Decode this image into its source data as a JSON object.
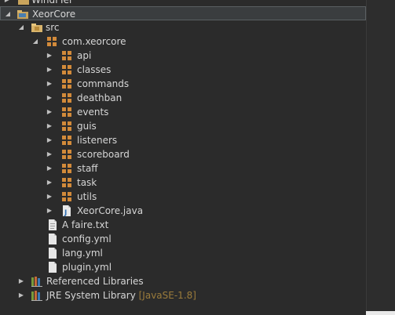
{
  "tree": {
    "top_partial": {
      "label": "WindFIer"
    },
    "project": {
      "label": "XeorCore"
    },
    "src_folder": {
      "label": "src"
    },
    "root_package": {
      "label": "com.xeorcore"
    },
    "packages": [
      {
        "label": "api"
      },
      {
        "label": "classes"
      },
      {
        "label": "commands"
      },
      {
        "label": "deathban"
      },
      {
        "label": "events"
      },
      {
        "label": "guis"
      },
      {
        "label": "listeners"
      },
      {
        "label": "scoreboard"
      },
      {
        "label": "staff"
      },
      {
        "label": "task"
      },
      {
        "label": "utils"
      }
    ],
    "java_file": {
      "label": "XeorCore.java"
    },
    "files": [
      {
        "label": "A faire.txt"
      },
      {
        "label": "config.yml"
      },
      {
        "label": "lang.yml"
      },
      {
        "label": "plugin.yml"
      }
    ],
    "referenced_libraries": {
      "label": "Referenced Libraries"
    },
    "jre": {
      "label": "JRE System Library",
      "decoration": "[JavaSE-1.8]"
    }
  },
  "colors": {
    "background": "#2b2b2b",
    "selection": "#3a3d3f",
    "text": "#d6d6d6",
    "decoration": "#9a7b3b"
  }
}
